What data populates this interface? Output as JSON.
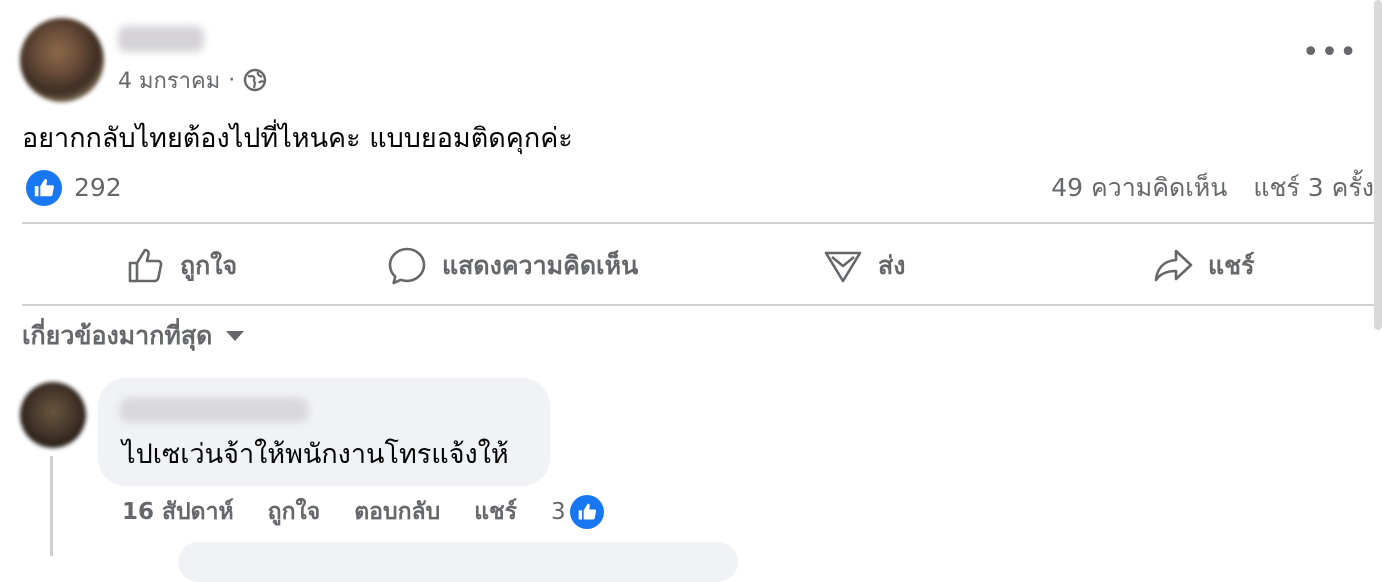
{
  "post": {
    "date": "4 มกราคม",
    "separator": "·",
    "more_label": "•••",
    "text": "อยากกลับไทยต้องไปที่ไหนคะ แบบยอมติดคุกค่ะ",
    "reaction_count": "292",
    "comments_count": "49 ความคิดเห็น",
    "shares_count": "แชร์ 3 ครั้ง"
  },
  "actions": {
    "like": "ถูกใจ",
    "comment": "แสดงความคิดเห็น",
    "send": "ส่ง",
    "share": "แชร์"
  },
  "sort": {
    "label": "เกี่ยวข้องมากที่สุด"
  },
  "comment": {
    "text": "ไปเซเว่นจ้าให้พนักงานโทรแจ้งให้",
    "time": "16 สัปดาห์",
    "like": "ถูกใจ",
    "reply": "ตอบกลับ",
    "share": "แชร์",
    "reaction_count": "3"
  },
  "colors": {
    "accent": "#1877f2",
    "secondary_text": "#65676b",
    "bubble": "#f0f2f5"
  }
}
